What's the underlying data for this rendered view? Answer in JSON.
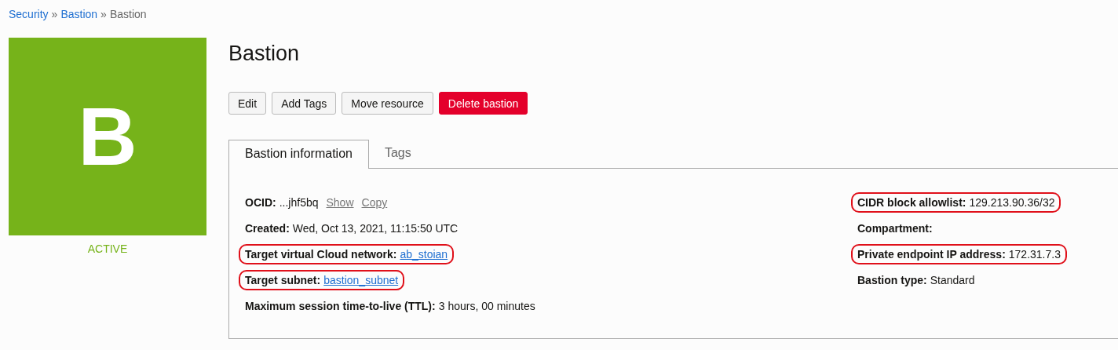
{
  "breadcrumb": [
    {
      "label": "Security",
      "kind": "link"
    },
    {
      "label": "Bastion",
      "kind": "link"
    },
    {
      "label": "Bastion",
      "kind": "current"
    }
  ],
  "breadcrumb_separator": "»",
  "tile": {
    "letter": "B",
    "status": "ACTIVE"
  },
  "title": "Bastion",
  "buttons": [
    {
      "label": "Edit",
      "kind": "default"
    },
    {
      "label": "Add Tags",
      "kind": "default"
    },
    {
      "label": "Move resource",
      "kind": "default"
    },
    {
      "label": "Delete bastion",
      "kind": "danger"
    }
  ],
  "tabs": [
    {
      "label": "Bastion information",
      "selected": true
    },
    {
      "label": "Tags",
      "selected": false
    }
  ],
  "left_fields": [
    {
      "label": "OCID:",
      "value": "...jhf5bq",
      "kind": "text",
      "actions": [
        "Show",
        "Copy"
      ],
      "highlighted": false
    },
    {
      "label": "Created:",
      "value": "Wed, Oct 13, 2021, 11:15:50 UTC",
      "kind": "text",
      "highlighted": false
    },
    {
      "label": "Target virtual Cloud network:",
      "value": "ab_stoian",
      "kind": "link",
      "highlighted": true
    },
    {
      "label": "Target subnet:",
      "value": "bastion_subnet",
      "kind": "link",
      "highlighted": true
    },
    {
      "label": "Maximum session time-to-live (TTL):",
      "value": "3 hours, 00 minutes",
      "kind": "text",
      "highlighted": false
    }
  ],
  "right_fields": [
    {
      "label": "CIDR block allowlist:",
      "value": "129.213.90.36/32",
      "kind": "text",
      "highlighted": true
    },
    {
      "label": "Compartment:",
      "kind": "redacted",
      "highlighted": false
    },
    {
      "label": "Private endpoint IP address:",
      "value": "172.31.7.3",
      "kind": "text",
      "highlighted": true
    },
    {
      "label": "Bastion type:",
      "value": "Standard",
      "kind": "text",
      "highlighted": false
    }
  ]
}
